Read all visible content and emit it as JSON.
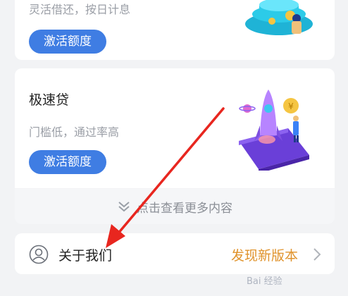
{
  "cards": [
    {
      "description": "灵活借还，按日计息",
      "button_label": "激活额度"
    },
    {
      "title": "极速贷",
      "description": "门槛低，通过率高",
      "button_label": "激活额度"
    }
  ],
  "more": {
    "label": "点击查看更多内容",
    "icon": "double-chevron-down-icon"
  },
  "about": {
    "icon": "user-circle-icon",
    "label": "关于我们",
    "update_label": "发现新版本",
    "chevron_icon": "chevron-right-icon"
  },
  "coin_symbol": "¥",
  "watermark": "Bai 经验",
  "colors": {
    "background": "#f2f3f5",
    "button": "#3f7de3",
    "update": "#e0932c",
    "annotation_arrow": "#e8261f"
  }
}
